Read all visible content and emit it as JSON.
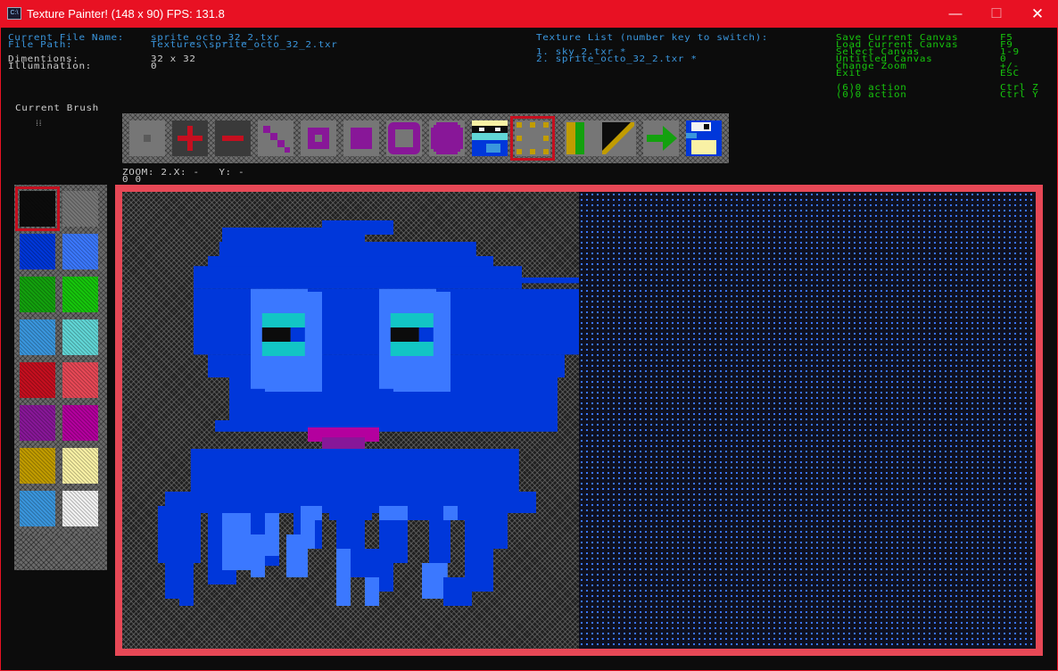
{
  "window": {
    "title": "Texture Painter! (148 x 90) FPS: 131.8",
    "icon_text": "C:\\",
    "controls": {
      "minimize": "—",
      "maximize": "☐",
      "close": "✕"
    }
  },
  "info": {
    "file_name_label": "Current File Name:",
    "file_name": "sprite_octo_32_2.txr",
    "file_path_label": "File Path:",
    "file_path": "Textures\\sprite_octo_32_2.txr",
    "dimensions_label": "Dimentions:",
    "dimensions": "32 x 32",
    "illumination_label": "Illumination:",
    "illumination": "0"
  },
  "texture_list": {
    "title": "Texture List (number key to switch):",
    "items": [
      "1. sky_2.txr *",
      "2. sprite_octo_32_2.txr *"
    ]
  },
  "shortcuts": [
    {
      "action": "Save Current Canvas",
      "key": "F5"
    },
    {
      "action": "Load Current Canvas",
      "key": "F9"
    },
    {
      "action": "Select Canvas",
      "key": "1-9"
    },
    {
      "action": "Untitled Canvas",
      "key": "0"
    },
    {
      "action": "Change Zoom",
      "key": "+/-"
    },
    {
      "action": "Exit",
      "key": "ESC"
    },
    {
      "action": "(6)0 action",
      "key": "Ctrl Z"
    },
    {
      "action": "(0)0 action",
      "key": "Ctrl Y"
    }
  ],
  "brush": {
    "label": "Current Brush",
    "glyph": "⁞⁞"
  },
  "status": {
    "zoom_line": "ZOOM: 2.X: -   Y: -",
    "second_line": "0 0"
  },
  "tools": [
    {
      "name": "tool-dot-small",
      "icon": "small-square-icon"
    },
    {
      "name": "tool-plus",
      "icon": "plus-icon"
    },
    {
      "name": "tool-minus",
      "icon": "minus-icon"
    },
    {
      "name": "tool-diagonal",
      "icon": "diagonal-line-icon"
    },
    {
      "name": "tool-square-outline",
      "icon": "square-outline-icon"
    },
    {
      "name": "tool-square-fill",
      "icon": "square-fill-icon"
    },
    {
      "name": "tool-rounded-outline",
      "icon": "rounded-square-icon"
    },
    {
      "name": "tool-circle-fill",
      "icon": "circle-fill-icon"
    },
    {
      "name": "tool-sprite-preview",
      "icon": "character-icon"
    },
    {
      "name": "tool-dotted-select",
      "icon": "dotted-select-icon"
    },
    {
      "name": "tool-split-color",
      "icon": "split-color-icon"
    },
    {
      "name": "tool-line-draw",
      "icon": "line-draw-icon"
    },
    {
      "name": "tool-arrow",
      "icon": "arrow-right-icon"
    },
    {
      "name": "tool-save",
      "icon": "floppy-disk-icon"
    }
  ],
  "selected_tool": "tool-dotted-select",
  "palette": {
    "colors": [
      [
        "#0c0c0c",
        "#767676"
      ],
      [
        "#0037da",
        "#3b78ff"
      ],
      [
        "#13a10e",
        "#16c60c"
      ],
      [
        "#3a96dd",
        "#61d6d6"
      ],
      [
        "#c50f1f",
        "#e74856"
      ],
      [
        "#881798",
        "#b4009e"
      ],
      [
        "#c19c00",
        "#f9f1a5"
      ],
      [
        "#3a96dd",
        "#f2f2f2"
      ]
    ],
    "selected": "#0c0c0c"
  },
  "colors": {
    "info_label": "#3a96dd",
    "info_value": "#cccccc",
    "shortcut": "#16c60c",
    "frame": "#e74856",
    "title_bar": "#e81123"
  }
}
